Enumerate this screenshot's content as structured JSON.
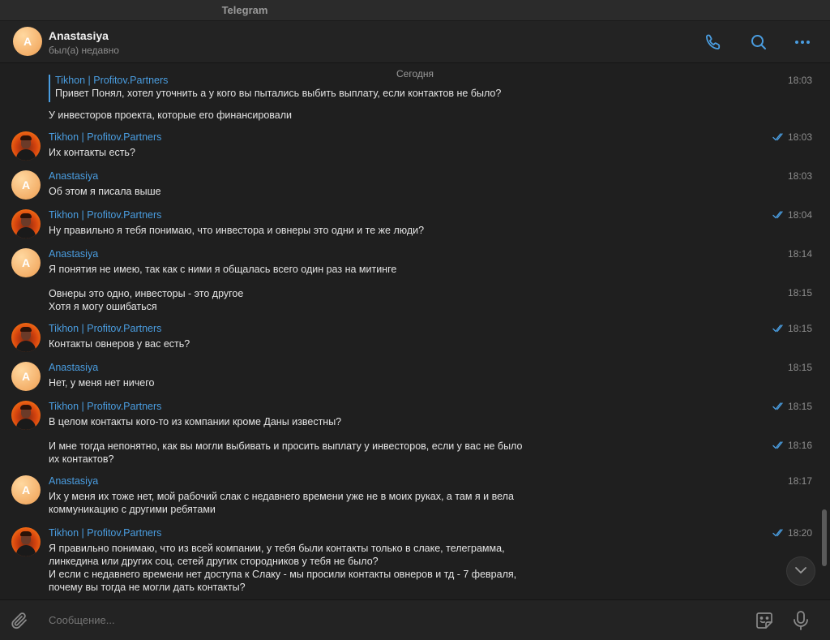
{
  "window": {
    "title": "Telegram"
  },
  "header": {
    "avatar_letter": "A",
    "name": "Anastasiya",
    "status": "был(а) недавно",
    "icons": [
      "phone-icon",
      "search-icon",
      "more-icon"
    ]
  },
  "chat": {
    "date_label": "Сегодня",
    "quote": {
      "name": "Tikhon | Profitov.Partners",
      "text": "Привет  Понял, хотел уточнить а у кого вы пытались выбить выплату, если контактов не было?"
    },
    "messages": [
      {
        "sender": "",
        "lines": [
          "У инвесторов проекта, которые его финансировали"
        ],
        "time": "18:03",
        "read": false
      },
      {
        "sender": "Tikhon | Profitov.Partners",
        "lines": [
          "Их контакты есть?"
        ],
        "time": "18:03",
        "read": true
      },
      {
        "sender": "Anastasiya",
        "lines": [
          "Об этом я писала выше"
        ],
        "time": "18:03",
        "read": false
      },
      {
        "sender": "Tikhon | Profitov.Partners",
        "lines": [
          "Ну правильно я тебя понимаю, что инвестора и овнеры это одни и те же люди?"
        ],
        "time": "18:04",
        "read": true
      },
      {
        "sender": "Anastasiya",
        "lines": [
          "Я понятия не имею, так как с ними я общалась всего один раз на митинге"
        ],
        "time": "18:14",
        "read": false
      },
      {
        "sender": "",
        "lines": [
          "Овнеры это одно, инвесторы - это другое",
          "Хотя я могу ошибаться"
        ],
        "time": "18:15",
        "read": false
      },
      {
        "sender": "Tikhon | Profitov.Partners",
        "lines": [
          "Контакты овнеров у вас есть?"
        ],
        "time": "18:15",
        "read": true
      },
      {
        "sender": "Anastasiya",
        "lines": [
          "Нет, у меня нет ничего"
        ],
        "time": "18:15",
        "read": false
      },
      {
        "sender": "Tikhon | Profitov.Partners",
        "lines": [
          "В целом контакты кого-то из компании кроме Даны известны?"
        ],
        "time": "18:15",
        "read": true
      },
      {
        "sender": "",
        "lines": [
          "И мне тогда непонятно, как вы могли выбивать и просить выплату у инвесторов, если у вас не было",
          "их контактов?"
        ],
        "time": "18:16",
        "read": true
      },
      {
        "sender": "Anastasiya",
        "lines": [
          "Их у меня их тоже нет, мой рабочий слак с недавнего времени уже не в моих руках, а там я и вела",
          "коммуникацию с другими ребятами"
        ],
        "time": "18:17",
        "read": false
      },
      {
        "sender": "Tikhon | Profitov.Partners",
        "lines": [
          "Я правильно понимаю, что из всей компании, у тебя были контакты только в слаке, телеграмма,",
          "линкедина или других соц. сетей других стородников у тебя не было?",
          "И если с недавнего времени нет доступа к Слаку - мы просили контакты овнеров и тд - 7 февраля,",
          "почему вы тогда не могли дать контакты?"
        ],
        "time": "18:20",
        "read": true
      }
    ]
  },
  "composer": {
    "placeholder": "Сообщение..."
  },
  "colors": {
    "accent": "#4a9de0",
    "background": "#1f1f1f",
    "panel": "#232323"
  }
}
